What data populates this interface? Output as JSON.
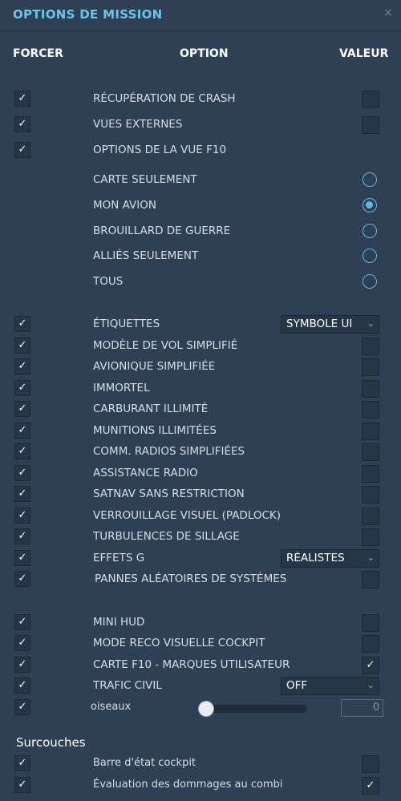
{
  "window": {
    "title": "OPTIONS DE MISSION",
    "close_icon": "×"
  },
  "headers": {
    "force": "FORCER",
    "option": "OPTION",
    "value": "VALEUR"
  },
  "check_glyph": "✓",
  "rows": {
    "crash_recovery": {
      "label": "RÉCUPÉRATION DE CRASH",
      "force": true,
      "value": false
    },
    "external_views": {
      "label": "VUES EXTERNES",
      "force": true,
      "value": false
    },
    "f10_view": {
      "label": "OPTIONS DE LA VUE F10",
      "force": true
    },
    "labels": {
      "label": "ÉTIQUETTES",
      "force": true,
      "value": "SYMBOLE UI"
    },
    "simplified_flight": {
      "label": "MODÈLE DE VOL SIMPLIFIÉ",
      "force": true,
      "value": false
    },
    "simplified_avionics": {
      "label": "AVIONIQUE SIMPLIFIÉE",
      "force": true,
      "value": false
    },
    "immortal": {
      "label": "IMMORTEL",
      "force": true,
      "value": false
    },
    "unlimited_fuel": {
      "label": "CARBURANT ILLIMITÉ",
      "force": true,
      "value": false
    },
    "unlimited_weapons": {
      "label": "MUNITIONS ILLIMITÉES",
      "force": true,
      "value": false
    },
    "easy_comms": {
      "label": "COMM. RADIOS SIMPLIFIÉES",
      "force": true,
      "value": false
    },
    "radio_assist": {
      "label": "ASSISTANCE RADIO",
      "force": true,
      "value": false
    },
    "unrestricted_satnav": {
      "label": "SATNAV SANS RESTRICTION",
      "force": true,
      "value": false
    },
    "padlock": {
      "label": "VERROUILLAGE VISUEL (PADLOCK)",
      "force": true,
      "value": false
    },
    "wake_turbulence": {
      "label": "TURBULENCES DE SILLAGE",
      "force": true,
      "value": false
    },
    "g_effects": {
      "label": "EFFETS G",
      "force": true,
      "value": "RÉALISTES"
    },
    "random_failures": {
      "label": "PANNES ALÉATOIRES DE SYSTÈMES",
      "force": true,
      "value": false
    },
    "mini_hud": {
      "label": "MINI HUD",
      "force": true,
      "value": false
    },
    "cockpit_recon": {
      "label": "MODE RECO VISUELLE COCKPIT",
      "force": true,
      "value": false
    },
    "f10_user_marks": {
      "label": "CARTE F10 - MARQUES UTILISATEUR",
      "force": true,
      "value": true
    },
    "civil_traffic": {
      "label": "TRAFIC CIVIL",
      "force": true,
      "value": "OFF"
    },
    "birds": {
      "label": "oiseaux",
      "force": true,
      "value": "0",
      "slider_fraction": 0
    },
    "cockpit_status_bar": {
      "label": "Barre d'état cockpit",
      "force": true,
      "value": false
    },
    "damage_assessment": {
      "label": "Évaluation des dommages au combi",
      "force": true,
      "value": true
    }
  },
  "f10_options": [
    {
      "label": "CARTE SEULEMENT",
      "selected": false
    },
    {
      "label": "MON AVION",
      "selected": true
    },
    {
      "label": "BROUILLARD DE GUERRE",
      "selected": false
    },
    {
      "label": "ALLIÉS SEULEMENT",
      "selected": false
    },
    {
      "label": "TOUS",
      "selected": false
    }
  ],
  "overlays_section": "Surcouches",
  "dropdown_arrow": "⌄",
  "colors": {
    "background": "#2f4055",
    "accent": "#6fc3ea",
    "radio": "#5fb8e4"
  }
}
